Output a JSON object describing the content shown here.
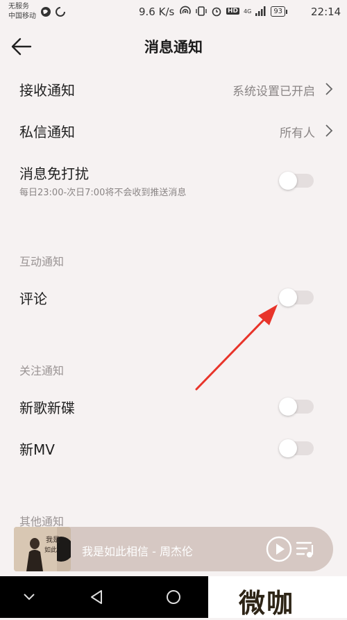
{
  "status_bar": {
    "carrier_line1": "无服务",
    "carrier_line2": "中国移动",
    "net_speed": "9.6 K/s",
    "network_type": "4G",
    "hd_badge": "HD",
    "battery": "93",
    "time": "22:14"
  },
  "header": {
    "title": "消息通知"
  },
  "settings": {
    "receive": {
      "label": "接收通知",
      "value": "系统设置已开启"
    },
    "private_msg": {
      "label": "私信通知",
      "value": "所有人"
    },
    "dnd": {
      "label": "消息免打扰",
      "sub": "每日23:00-次日7:00将不会收到推送消息",
      "on": false
    },
    "interaction_title": "互动通知",
    "comment": {
      "label": "评论",
      "on": false
    },
    "follow_title": "关注通知",
    "new_album": {
      "label": "新歌新碟",
      "on": false
    },
    "new_mv": {
      "label": "新MV",
      "on": false
    },
    "other_title": "其他通知"
  },
  "player": {
    "song": "我是如此相信 - 周杰伦",
    "cover_text": "我是如此相信"
  },
  "watermark": "微咖",
  "colors": {
    "accent_arrow": "#e8342a",
    "toggle_off": "#e4dede",
    "player_bg": "#d6c8c3"
  },
  "icons": [
    "back-arrow-icon",
    "chevron-right-icon",
    "play-icon",
    "playlist-icon",
    "nav-back-icon",
    "nav-home-icon",
    "nav-recent-icon"
  ]
}
